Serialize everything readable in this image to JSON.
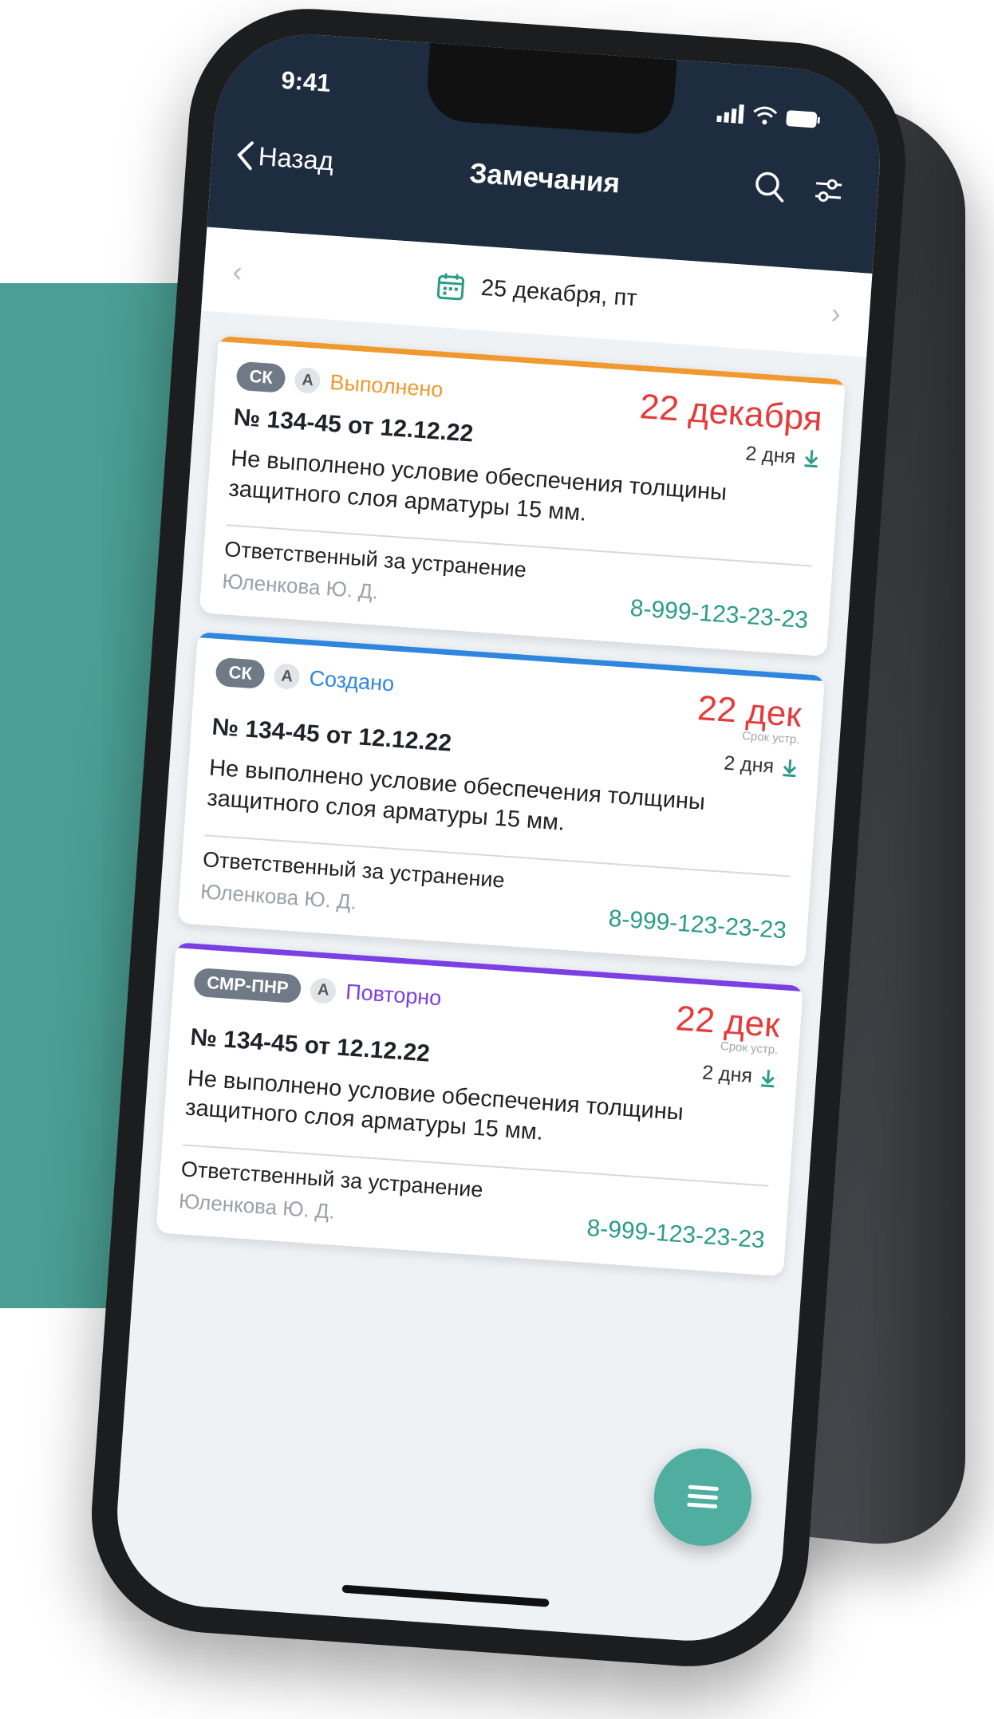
{
  "colors": {
    "teal_block": "#4a9e93",
    "header_bg": "#1d2d3f",
    "accent_orange": "#f0992f",
    "accent_blue": "#2e86de",
    "accent_purple": "#7b3fe4",
    "deadline_red": "#e53b3b",
    "phone_green": "#2b9c8a"
  },
  "status_bar": {
    "time": "9:41",
    "icons": [
      "signal-icon",
      "wifi-icon",
      "battery-icon"
    ]
  },
  "nav": {
    "back_label": "Назад",
    "title": "Замечания",
    "icons": [
      "search-icon",
      "filter-icon"
    ]
  },
  "date_bar": {
    "date": "25 декабря, пт"
  },
  "cards": [
    {
      "type_badge": "СК",
      "letter_badge": "А",
      "status": "Выполнено",
      "status_color": "#f0992f",
      "deadline": "22 декабря",
      "deadline_sub": "",
      "number": "№ 134-45 от 12.12.22",
      "duration": "2 дня",
      "description": "Не выполнено условие обеспечения толщины защитного слоя арматуры 15 мм.",
      "responsible_label": "Ответственный за устранение",
      "responsible_name": "Юленкова Ю. Д.",
      "phone": "8-999-123-23-23"
    },
    {
      "type_badge": "СК",
      "letter_badge": "А",
      "status": "Создано",
      "status_color": "#2e86de",
      "deadline": "22 дек",
      "deadline_sub": "Срок устр.",
      "number": "№ 134-45 от 12.12.22",
      "duration": "2 дня",
      "description": "Не выполнено условие обеспечения толщины защитного слоя арматуры 15 мм.",
      "responsible_label": "Ответственный за устранение",
      "responsible_name": "Юленкова Ю. Д.",
      "phone": "8-999-123-23-23"
    },
    {
      "type_badge": "СМР-ПНР",
      "letter_badge": "А",
      "status": "Повторно",
      "status_color": "#7b3fe4",
      "deadline": "22 дек",
      "deadline_sub": "Срок устр.",
      "number": "№ 134-45 от 12.12.22",
      "duration": "2 дня",
      "description": "Не выполнено условие обеспечения толщины защитного слоя арматуры 15 мм.",
      "responsible_label": "Ответственный за устранение",
      "responsible_name": "Юленкова Ю. Д.",
      "phone": "8-999-123-23-23"
    }
  ],
  "fab": {
    "icon": "menu-icon"
  }
}
